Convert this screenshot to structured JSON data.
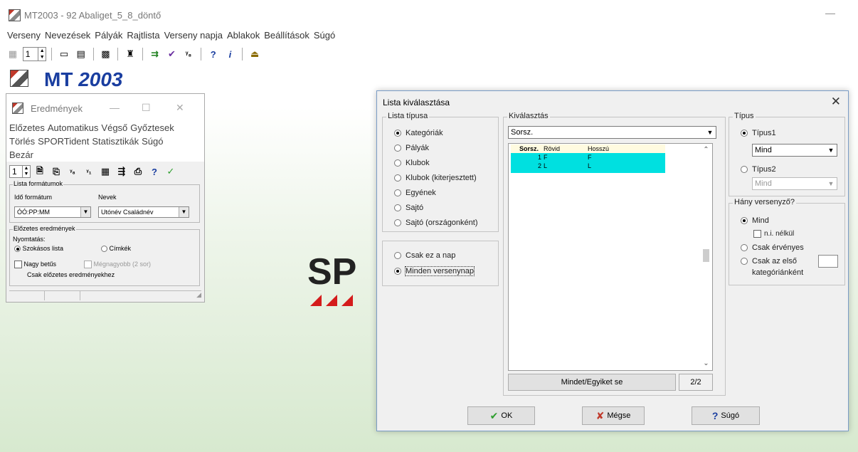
{
  "app": {
    "title": "MT2003  -  92 Abaliget_5_8_döntő",
    "logo_text_a": "MT",
    "logo_text_b": "2003",
    "sport_logo": "SP"
  },
  "menubar": [
    "Verseny",
    "Nevezések",
    "Pályák",
    "Rajtlista",
    "Verseny napja",
    "Ablakok",
    "Beállítások",
    "Súgó"
  ],
  "toolbar": {
    "spin_value": "1"
  },
  "eredmenyek": {
    "title": "Eredmények",
    "menu_row1": [
      "Előzetes",
      "Automatikus",
      "Végső",
      "Győztesek"
    ],
    "menu_row2": [
      "Törlés",
      "SPORTident",
      "Statisztikák",
      "Súgó"
    ],
    "menu_row3": [
      "Bezár"
    ],
    "spin_value": "1",
    "lista_formatumok": "Lista formátumok",
    "ido_formatum_label": "Idő formátum",
    "nevek_label": "Nevek",
    "ido_formatum_value": "ÓÓ:PP:MM",
    "nevek_value": "Utónév Családnév",
    "elozetes_eredmenyek": "Előzetes eredmények",
    "nyomtatas": "Nyomtatás:",
    "szokasos_lista": "Szokásos lista",
    "cimkek": "Címkék",
    "nagy_betus": "Nagy betűs",
    "megnagyobb": "Mégnagyobb (2 sor)",
    "csak_elozetes": "Csak előzetes eredményekhez"
  },
  "dialog": {
    "title": "Lista kiválasztása",
    "lista_tipusa": "Lista típusa",
    "lista_items": [
      "Kategóriák",
      "Pályák",
      "Klubok",
      "Klubok (kiterjesztett)",
      "Egyének",
      "Sajtó",
      "Sajtó (országonként)"
    ],
    "lista_selected": "Kategóriák",
    "csak_ez_a_nap": "Csak ez a nap",
    "minden_versenynap": "Minden versenynap",
    "kivalasztas": "Kiválasztás",
    "sort_value": "Sorsz.",
    "columns": [
      "Sorsz.",
      "Rövid",
      "Hosszú"
    ],
    "rows": [
      {
        "sorsz": "1",
        "rovid": "F",
        "hosszu": "F"
      },
      {
        "sorsz": "2",
        "rovid": "L",
        "hosszu": "L"
      }
    ],
    "mindet_button": "Mindet/Egyiket se",
    "count": "2/2",
    "tipus": "Típus",
    "tipus1": "Típus1",
    "tipus1_value": "Mind",
    "tipus2": "Típus2",
    "tipus2_value": "Mind",
    "hany_versenyzo": "Hány versenyző?",
    "mind": "Mind",
    "ni_nelkul": "n.i. nélkül",
    "csak_ervenyes": "Csak érvényes",
    "csak_az_elso": "Csak az első",
    "kategoriankent": "kategóriánként",
    "ok": "OK",
    "megse": "Mégse",
    "sugo": "Súgó"
  },
  "colors": {
    "selection": "#00e0e0",
    "header_row": "#fffbe0",
    "ok_check": "#2e9e2e",
    "cancel_x": "#c0392b",
    "help_q": "#1a3ea0"
  }
}
